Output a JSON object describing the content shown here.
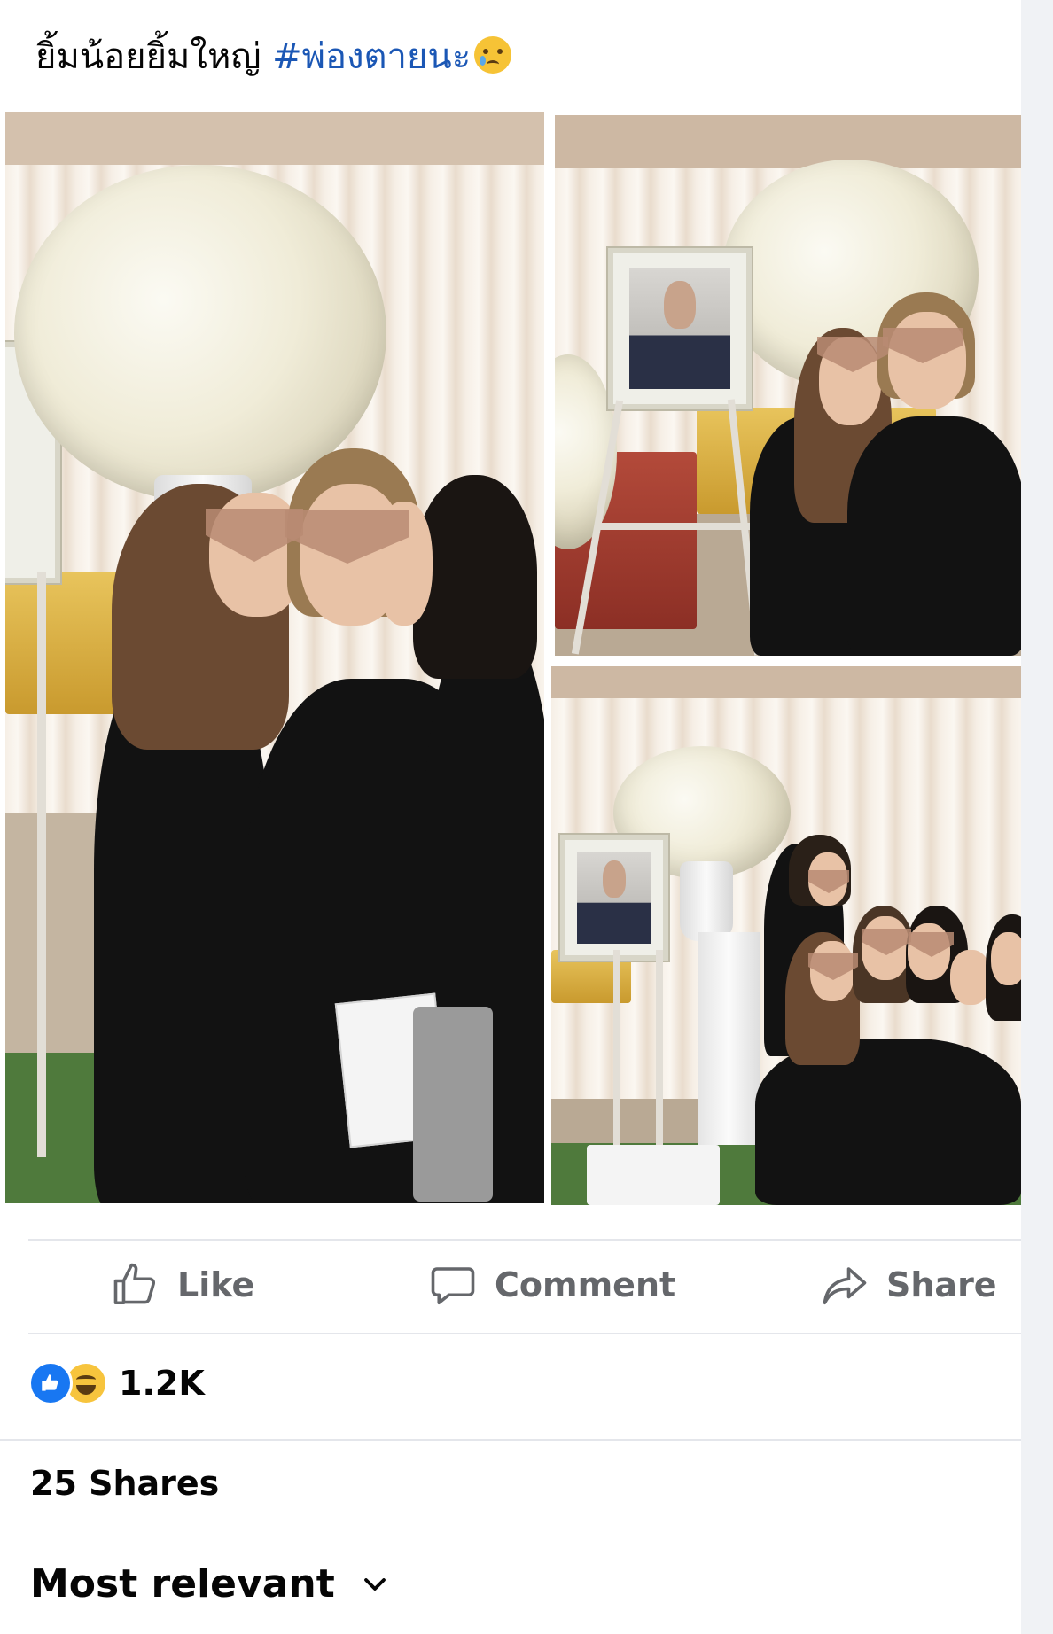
{
  "post": {
    "caption_text": "ยิ้มน้อยยิ้มใหญ่ ",
    "hashtag": "#พ่องตายนะ",
    "caption_emoji": "crying-face-emoji"
  },
  "photos": [
    {
      "name": "photo-three-women-funeral"
    },
    {
      "name": "photo-two-women-portrait"
    },
    {
      "name": "photo-group-hug"
    }
  ],
  "actions": {
    "like_label": "Like",
    "comment_label": "Comment",
    "share_label": "Share",
    "like_icon": "thumbs-up-icon",
    "comment_icon": "speech-bubble-icon",
    "share_icon": "share-arrow-icon"
  },
  "reactions": {
    "types": [
      "like-reaction-icon",
      "haha-reaction-icon"
    ],
    "count": "1.2K"
  },
  "shares_text": "25 Shares",
  "sort": {
    "label": "Most relevant",
    "icon": "chevron-down-icon"
  },
  "colors": {
    "hashtag": "#1b57b5",
    "action_text": "#65676b",
    "like_blue": "#1877f2",
    "haha_yellow": "#f7c43d",
    "divider": "#e4e6eb",
    "side_strip": "#f0f2f5"
  }
}
